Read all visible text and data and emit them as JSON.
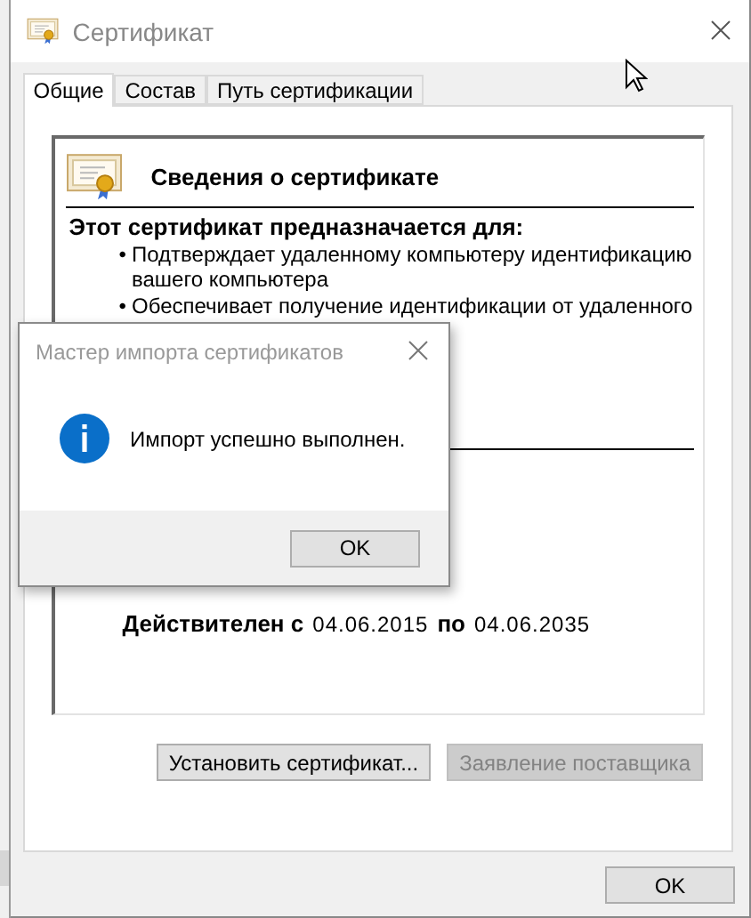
{
  "window": {
    "title": "Сертификат"
  },
  "tabs": [
    {
      "label": "Общие",
      "selected": true
    },
    {
      "label": "Состав",
      "selected": false
    },
    {
      "label": "Путь сертификации",
      "selected": false
    }
  ],
  "certificate": {
    "heading": "Сведения о сертификате",
    "purpose_title": "Этот сертификат предназначается для:",
    "purposes": [
      {
        "bullet": "•",
        "text": "Подтверждает удаленному компьютеру идентификацию вашего компьютера"
      },
      {
        "bullet": "•",
        "text": "Обеспечивает получение идентификации от удаленного"
      }
    ],
    "validity": {
      "from_label": "Действителен с",
      "from": "04.06.2015",
      "to_label": "по",
      "to": "04.06.2035"
    }
  },
  "buttons": [
    {
      "label": "Установить сертификат...",
      "disabled": false
    },
    {
      "label": "Заявление поставщика",
      "disabled": true
    }
  ],
  "ok_button": "OK",
  "dialog": {
    "title": "Мастер импорта сертификатов",
    "kind": "info",
    "message": "Импорт успешно выполнен.",
    "ok_button": "OK"
  }
}
